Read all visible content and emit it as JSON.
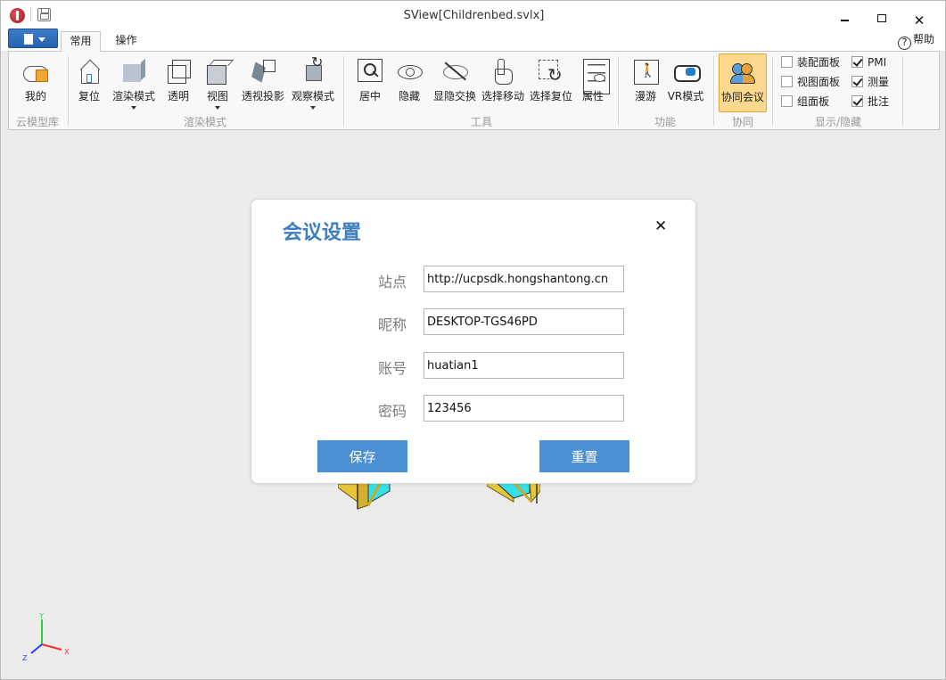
{
  "window": {
    "title": "SView[Childrenbed.svlx]",
    "close_glyph": "✕"
  },
  "tabs": {
    "home": "常用",
    "operate": "操作",
    "help": "帮助",
    "help_glyph": "?"
  },
  "ribbon": {
    "groups": {
      "cloud": "云模型库",
      "render": "渲染模式",
      "tools": "工具",
      "function": "功能",
      "collab": "协同",
      "display": "显示/隐藏"
    },
    "buttons": {
      "mine": "我的",
      "reset_view": "复位",
      "render_mode": "渲染模式",
      "transparent": "透明",
      "view": "视图",
      "perspective": "透视投影",
      "observe_mode": "观察模式",
      "center": "居中",
      "hide": "隐藏",
      "show_hide_swap": "显隐交换",
      "select_move": "选择移动",
      "select_reset": "选择复位",
      "properties": "属性",
      "roam": "漫游",
      "vr_mode": "VR模式",
      "meeting": "协同会议"
    },
    "checkboxes": [
      {
        "label": "装配面板",
        "checked": false
      },
      {
        "label": "视图面板",
        "checked": false
      },
      {
        "label": "组面板",
        "checked": false
      },
      {
        "label": "PMI",
        "checked": true
      },
      {
        "label": "测量",
        "checked": true
      },
      {
        "label": "批注",
        "checked": true
      }
    ]
  },
  "dialog": {
    "title": "会议设置",
    "close_glyph": "✕",
    "fields": {
      "site": {
        "label": "站点",
        "value": "http://ucpsdk.hongshantong.cn"
      },
      "nickname": {
        "label": "昵称",
        "value": "DESKTOP-TGS46PD"
      },
      "account": {
        "label": "账号",
        "value": "huatian1"
      },
      "password": {
        "label": "密码",
        "value": "123456"
      }
    },
    "save_label": "保存",
    "reset_label": "重置"
  },
  "axis": {
    "x": "X",
    "y": "Y",
    "z": "Z"
  },
  "colors": {
    "accent": "#3d7fc0",
    "button": "#4a90d2",
    "active_ribbon": "#fcd98f",
    "model_yellow": "#e8c63a",
    "model_cyan": "#35e0e8"
  }
}
